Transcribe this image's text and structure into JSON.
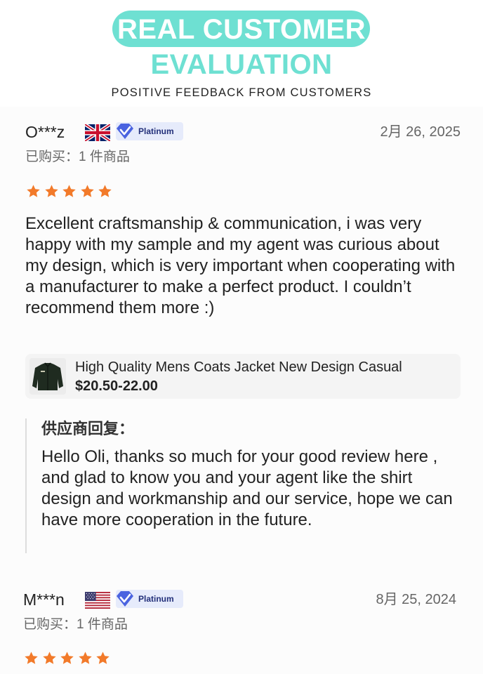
{
  "header": {
    "title_line1": "REAL CUSTOMER",
    "title_line2": "EVALUATION",
    "subtitle": "POSITIVE FEEDBACK FROM CUSTOMERS"
  },
  "colors": {
    "accent": "#6ee0d2",
    "star": "#f27a2a",
    "badge_bg": "#e6ebfb",
    "badge_icon": "#4a63e0"
  },
  "reviews": [
    {
      "user": "O***z",
      "flag_icon": "uk-flag-icon",
      "badge": "Platinum",
      "date": "2月 26, 2025",
      "bought": "已购买：1 件商品",
      "rating": 5,
      "text": "Excellent craftsmanship & communication, i was very happy with my sample and my agent was curious about my design, which is very important when cooperating with a manufacturer to make a perfect product. I couldn’t recommend them more :)",
      "product": {
        "title": "High Quality Mens Coats Jacket New Design Casual",
        "price": "$20.50-22.00",
        "thumb_icon": "jacket-thumbnail"
      },
      "reply": {
        "title": "供应商回复：",
        "text": "Hello Oli, thanks so much for your good review here , and glad to know you and your agent like the shirt design and workmanship and our service, hope we can have more cooperation in the future."
      }
    },
    {
      "user": "M***n",
      "flag_icon": "us-flag-icon",
      "badge": "Platinum",
      "date": "8月 25, 2024",
      "bought": "已购买：1 件商品",
      "rating": 5
    }
  ]
}
